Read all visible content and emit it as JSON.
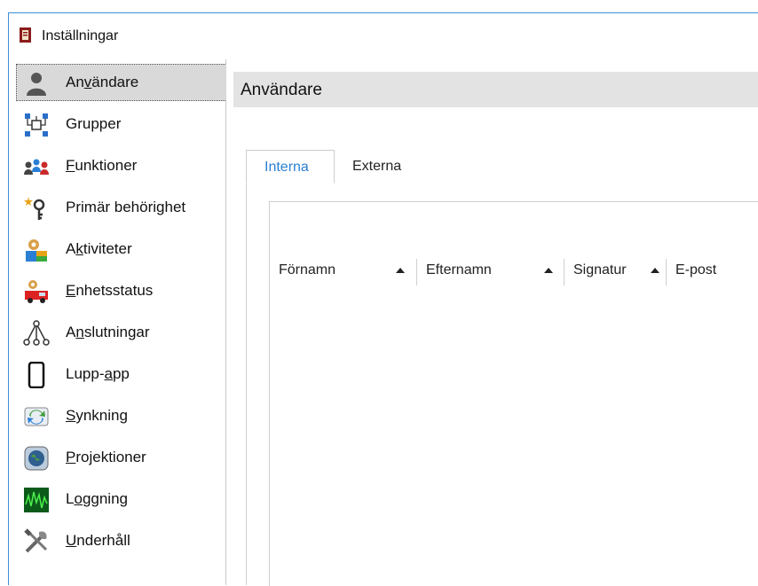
{
  "window": {
    "title": "Inställningar"
  },
  "sidebar": {
    "items": [
      {
        "label_pre": "An",
        "label_ul": "v",
        "label_post": "ändare",
        "icon": "user-icon",
        "selected": true
      },
      {
        "label_pre": "",
        "label_ul": "",
        "label_post": "Grupper",
        "icon": "groups-icon"
      },
      {
        "label_pre": "",
        "label_ul": "F",
        "label_post": "unktioner",
        "icon": "functions-icon"
      },
      {
        "label_pre": "",
        "label_ul": "",
        "label_post": "Primär behörighet",
        "icon": "key-icon"
      },
      {
        "label_pre": "A",
        "label_ul": "k",
        "label_post": "tiviteter",
        "icon": "activities-icon"
      },
      {
        "label_pre": "",
        "label_ul": "E",
        "label_post": "nhetsstatus",
        "icon": "fire-truck-icon"
      },
      {
        "label_pre": "A",
        "label_ul": "n",
        "label_post": "slutningar",
        "icon": "connections-icon"
      },
      {
        "label_pre": "Lupp-",
        "label_ul": "a",
        "label_post": "pp",
        "icon": "phone-icon"
      },
      {
        "label_pre": "",
        "label_ul": "S",
        "label_post": "ynkning",
        "icon": "sync-icon"
      },
      {
        "label_pre": "",
        "label_ul": "P",
        "label_post": "rojektioner",
        "icon": "projection-icon"
      },
      {
        "label_pre": "L",
        "label_ul": "o",
        "label_post": "ggning",
        "icon": "logging-icon"
      },
      {
        "label_pre": "",
        "label_ul": "U",
        "label_post": "nderhåll",
        "icon": "tools-icon"
      }
    ]
  },
  "content": {
    "title": "Användare",
    "tabs": [
      {
        "label": "Interna",
        "active": true
      },
      {
        "label": "Externa",
        "active": false
      }
    ],
    "columns": [
      "Förnamn",
      "Efternamn",
      "Signatur",
      "E-post"
    ]
  },
  "colors": {
    "accent": "#2a7fd4",
    "header_bg": "#e3e3e3",
    "selected_bg": "#d9d9d9"
  }
}
